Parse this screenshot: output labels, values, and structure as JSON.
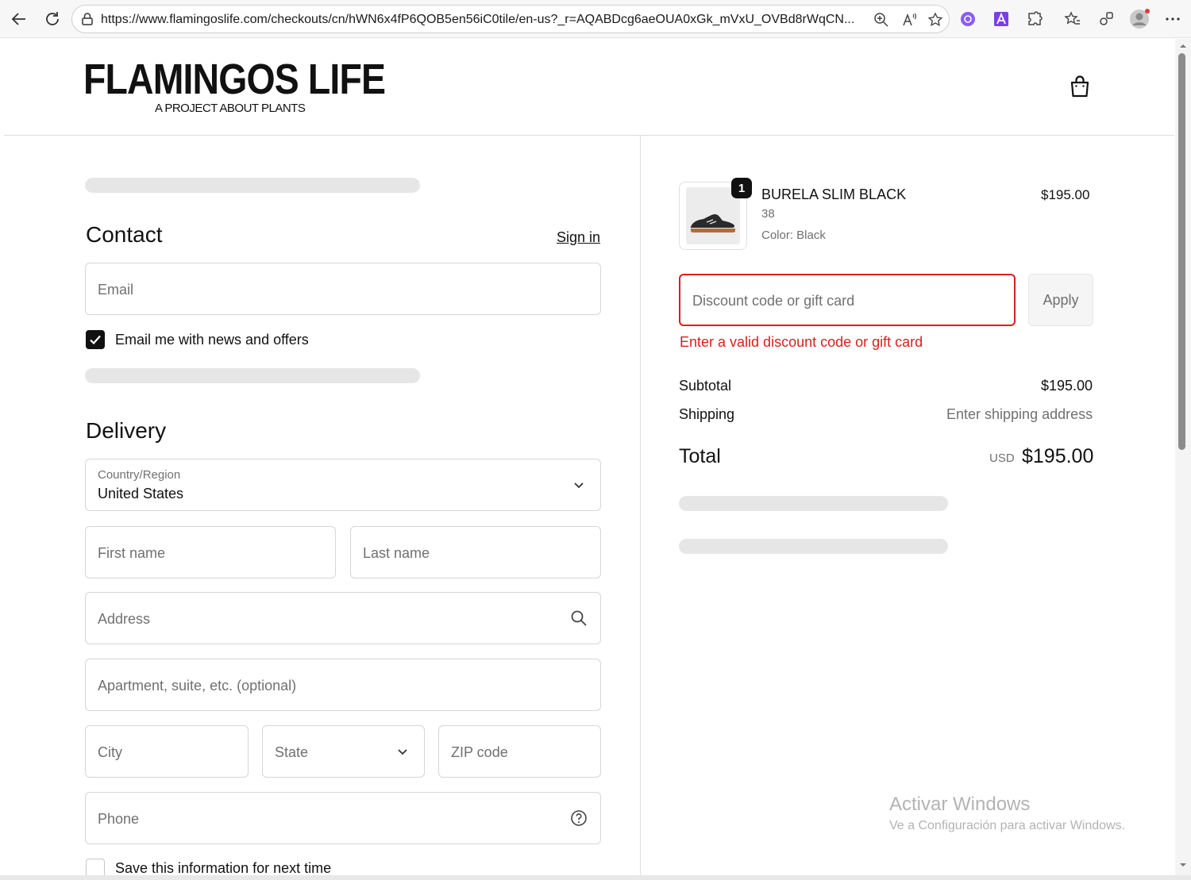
{
  "browser": {
    "url": "https://www.flamingoslife.com/checkouts/cn/hWN6x4fP6QOB5en56iC0tile/en-us?_r=AQABDcg6aeOUA0xGk_mVxU_OVBd8rWqCN..."
  },
  "header": {
    "logo": "FLAMINGOS LIFE",
    "tagline": "A PROJECT ABOUT PLANTS"
  },
  "contact": {
    "title": "Contact",
    "sign_in": "Sign in",
    "email_placeholder": "Email",
    "newsletter_label": "Email me with news and offers",
    "newsletter_checked": true
  },
  "delivery": {
    "title": "Delivery",
    "country_label": "Country/Region",
    "country_value": "United States",
    "first_name": "First name",
    "last_name": "Last name",
    "address": "Address",
    "apartment": "Apartment, suite, etc. (optional)",
    "city": "City",
    "state": "State",
    "zip": "ZIP code",
    "phone": "Phone",
    "save_info": "Save this information for next time"
  },
  "order": {
    "item": {
      "quantity": "1",
      "name": "BURELA SLIM BLACK",
      "size": "38",
      "color": "Color: Black",
      "price": "$195.00"
    },
    "discount_placeholder": "Discount code or gift card",
    "apply_label": "Apply",
    "discount_error": "Enter a valid discount code or gift card",
    "subtotal_label": "Subtotal",
    "subtotal_value": "$195.00",
    "shipping_label": "Shipping",
    "shipping_value": "Enter shipping address",
    "total_label": "Total",
    "currency": "USD",
    "total_value": "$195.00"
  },
  "watermark": {
    "line1": "Activar Windows",
    "line2": "Ve a Configuración para activar Windows."
  },
  "colors": {
    "error": "#dd1d1d",
    "text": "#111111",
    "muted": "#707070",
    "skeleton": "#e6e6e6"
  }
}
